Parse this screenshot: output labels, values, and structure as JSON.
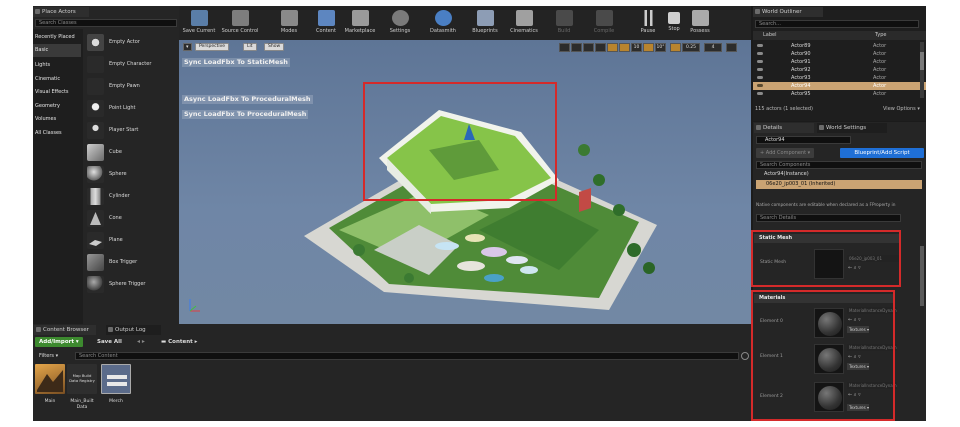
{
  "place_actors": {
    "tab": "Place Actors",
    "search_placeholder": "Search Classes",
    "categories": [
      "Recently Placed",
      "Basic",
      "Lights",
      "Cinematic",
      "Visual Effects",
      "Geometry",
      "Volumes",
      "All Classes"
    ],
    "actors": [
      "Empty Actor",
      "Empty Character",
      "Empty Pawn",
      "Point Light",
      "Player Start",
      "Cube",
      "Sphere",
      "Cylinder",
      "Cone",
      "Plane",
      "Box Trigger",
      "Sphere Trigger"
    ]
  },
  "toolbar": {
    "buttons": [
      "Save Current",
      "Source Control",
      "Modes",
      "Content",
      "Marketplace",
      "Settings",
      "Datasmith",
      "Blueprints",
      "Cinematics",
      "Build",
      "Compile",
      "Pause",
      "Stop",
      "Possess"
    ]
  },
  "viewport": {
    "perspective": "Perspective",
    "lit": "Lit",
    "show": "Show",
    "snap_values": [
      "10",
      "10°",
      "0.25",
      "4"
    ],
    "overlay_lines": [
      "Sync LoadFbx To StaticMesh",
      "Async LoadFbx To ProceduralMesh",
      "Sync LoadFbx To ProceduralMesh"
    ]
  },
  "outliner": {
    "tab": "World Outliner",
    "search_placeholder": "Search...",
    "col_label": "Label",
    "col_type": "Type",
    "rows": [
      {
        "label": "Actor89",
        "type": "Actor"
      },
      {
        "label": "Actor90",
        "type": "Actor"
      },
      {
        "label": "Actor91",
        "type": "Actor"
      },
      {
        "label": "Actor92",
        "type": "Actor"
      },
      {
        "label": "Actor93",
        "type": "Actor"
      },
      {
        "label": "Actor94",
        "type": "Actor"
      },
      {
        "label": "Actor95",
        "type": "Actor"
      }
    ],
    "status": "115 actors (1 selected)",
    "view_options": "View Options ▾"
  },
  "details": {
    "tab_details": "Details",
    "tab_world": "World Settings",
    "actor_name": "Actor94",
    "add_component": "+ Add Component ▾",
    "blueprint_btn": "Blueprint/Add Script",
    "search_components": "Search Components",
    "instance": "Actor94(Instance)",
    "mesh_component": "06e20_jp003_01 (Inherited)",
    "native_note": "Native components are editable when declared as a FProperty in",
    "search_details": "Search Details",
    "static_mesh_section": "Static Mesh",
    "static_mesh_label": "Static Mesh",
    "static_mesh_value": "06e20_jp003_01",
    "materials_section": "Materials",
    "elements": [
      {
        "label": "Element 0",
        "name": "MaterialInstanceDynamic_1a",
        "mode": "Textures ▾"
      },
      {
        "label": "Element 1",
        "name": "MaterialInstanceDynamic_2a",
        "mode": "Textures ▾"
      },
      {
        "label": "Element 2",
        "name": "MaterialInstanceDynamic_3a",
        "mode": "Textures ▾"
      }
    ]
  },
  "content_browser": {
    "tab": "Content Browser",
    "tab_output": "Output Log",
    "add_import": "Add/Import ▾",
    "save_all": "Save All",
    "path": "Content",
    "filters": "Filters ▾",
    "search_placeholder": "Search Content",
    "assets": [
      {
        "label": "Main",
        "thumb_text": ""
      },
      {
        "label": "Main_Built\nData",
        "thumb_text": "Map Build\nData Registry"
      },
      {
        "label": "Merch",
        "thumb_text": ""
      }
    ]
  },
  "colors": {
    "accent_blue": "#1f6fd6",
    "green": "#3d8a2f",
    "highlight_red": "#d42a2a",
    "selected_row": "#caa373"
  }
}
